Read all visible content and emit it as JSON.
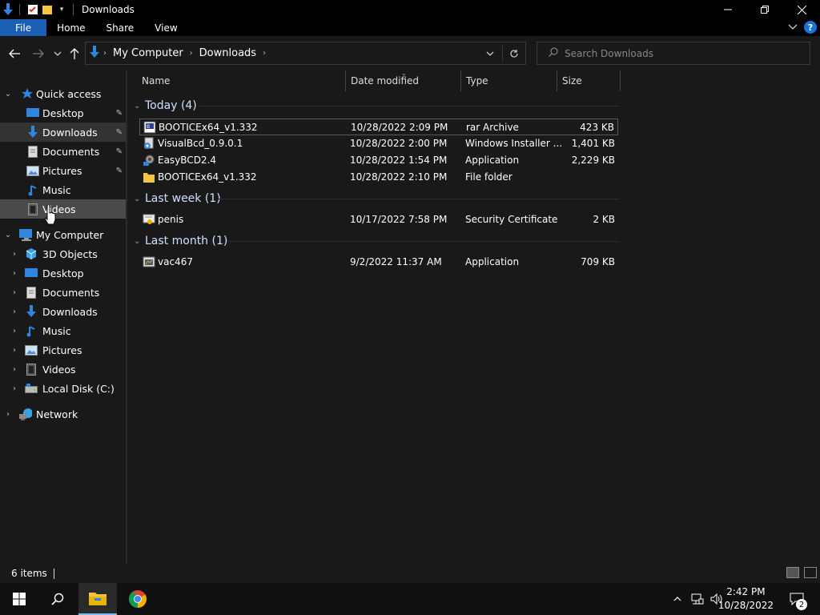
{
  "window": {
    "title": "Downloads"
  },
  "ribbon": {
    "tabs": [
      "File",
      "Home",
      "Share",
      "View"
    ],
    "help_label": "?"
  },
  "address": {
    "crumbs": [
      "My Computer",
      "Downloads"
    ]
  },
  "search": {
    "placeholder": "Search Downloads"
  },
  "sidebar": {
    "quick_access": {
      "label": "Quick access",
      "items": [
        "Desktop",
        "Downloads",
        "Documents",
        "Pictures",
        "Music",
        "Videos"
      ]
    },
    "my_computer": {
      "label": "My Computer",
      "items": [
        "3D Objects",
        "Desktop",
        "Documents",
        "Downloads",
        "Music",
        "Pictures",
        "Videos",
        "Local Disk (C:)"
      ]
    },
    "network": {
      "label": "Network"
    }
  },
  "columns": {
    "name": "Name",
    "date": "Date modified",
    "type": "Type",
    "size": "Size"
  },
  "groups": [
    {
      "label": "Today (4)",
      "files": [
        {
          "name": "BOOTICEx64_v1.332",
          "date": "10/28/2022 2:09 PM",
          "type": "rar Archive",
          "size": "423 KB",
          "icon": "rar-icon"
        },
        {
          "name": "VisualBcd_0.9.0.1",
          "date": "10/28/2022 2:00 PM",
          "type": "Windows Installer ...",
          "size": "1,401 KB",
          "icon": "installer-icon"
        },
        {
          "name": "EasyBCD2.4",
          "date": "10/28/2022 1:54 PM",
          "type": "Application",
          "size": "2,229 KB",
          "icon": "application-icon"
        },
        {
          "name": "BOOTICEx64_v1.332",
          "date": "10/28/2022 2:10 PM",
          "type": "File folder",
          "size": "",
          "icon": "folder-icon"
        }
      ]
    },
    {
      "label": "Last week (1)",
      "files": [
        {
          "name": "penis",
          "date": "10/17/2022 7:58 PM",
          "type": "Security Certificate",
          "size": "2 KB",
          "icon": "certificate-icon"
        }
      ]
    },
    {
      "label": "Last month (1)",
      "files": [
        {
          "name": "vac467",
          "date": "9/2/2022 11:37 AM",
          "type": "Application",
          "size": "709 KB",
          "icon": "application-icon"
        }
      ]
    }
  ],
  "status": {
    "count": "6 items"
  },
  "taskbar": {
    "time": "2:42 PM",
    "date": "10/28/2022",
    "notification_count": "2"
  },
  "colors": {
    "accent": "#1a5fb4",
    "folder": "#f4c542",
    "download_blue": "#2f86e0"
  }
}
